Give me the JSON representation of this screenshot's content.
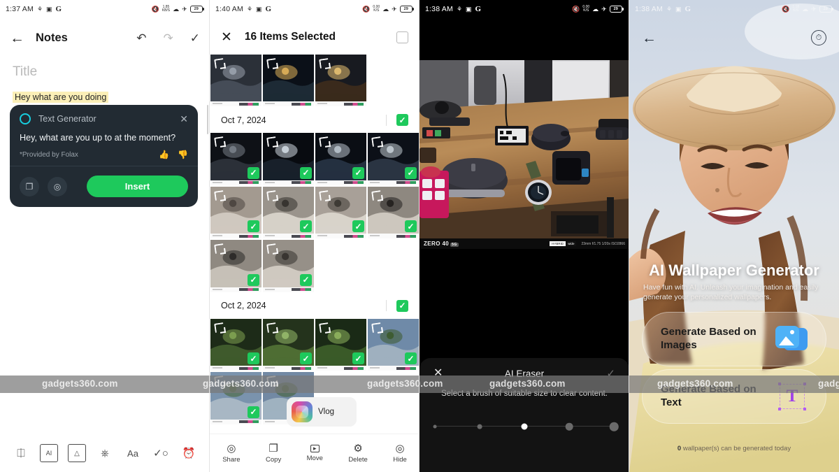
{
  "watermark": {
    "text": "gadgets360.com",
    "positions": [
      60,
      290,
      525,
      700,
      940,
      1170
    ]
  },
  "panel1": {
    "status": {
      "time": "1:37 AM",
      "net_rate": "1.85",
      "net_unit": "KB/S",
      "battery": "29",
      "icons": [
        "bluetooth-icon",
        "sim-icon",
        "google-icon",
        "mute-icon",
        "data-rate-icon",
        "wifi-icon",
        "airplane-icon",
        "battery-icon"
      ]
    },
    "appbar": {
      "back": "←",
      "title": "Notes",
      "undo": "↶",
      "redo": "↷",
      "done": "✓"
    },
    "note": {
      "title_placeholder": "Title",
      "body_text": "Hey what are you doing"
    },
    "text_generator": {
      "name": "Text Generator",
      "close": "✕",
      "result": "Hey, what are you up to at the moment?",
      "provider": "*Provided by Folax",
      "thumbs_up": "👍",
      "thumbs_down": "👎",
      "copy": "❐",
      "share": "☄",
      "insert_label": "Insert",
      "accent_color": "#1ec95c",
      "ring_color": "#17cfe0"
    },
    "toolbar": [
      {
        "icon": "ⓐ",
        "name": "pen-icon"
      },
      {
        "icon": "AI",
        "name": "ai-image-icon"
      },
      {
        "icon": "⛰",
        "name": "image-icon"
      },
      {
        "icon": "♁",
        "name": "mic-icon"
      },
      {
        "icon": "Aa",
        "name": "text-format-icon"
      },
      {
        "icon": "✓",
        "name": "checklist-icon"
      },
      {
        "icon": "⏰",
        "name": "alarm-icon"
      }
    ]
  },
  "panel2": {
    "status": {
      "time": "1:40 AM",
      "net_rate": "0.00",
      "net_unit": "K/S",
      "battery": "29"
    },
    "appbar": {
      "close": "✕",
      "title": "16 Items Selected",
      "select_all": ""
    },
    "sections": [
      {
        "date": "",
        "checked": false,
        "photos": [
          {
            "selected": false,
            "style": "moon-cloud"
          },
          {
            "selected": false,
            "style": "night-street"
          },
          {
            "selected": false,
            "style": "night-town"
          }
        ]
      },
      {
        "date": "Oct 7, 2024",
        "checked": true,
        "photos": [
          {
            "selected": true,
            "style": "tower-a"
          },
          {
            "selected": true,
            "style": "tower-b"
          },
          {
            "selected": true,
            "style": "tower-c"
          },
          {
            "selected": true,
            "style": "tower-d"
          },
          {
            "selected": true,
            "style": "stair-a"
          },
          {
            "selected": true,
            "style": "stair-b"
          },
          {
            "selected": true,
            "style": "stair-c"
          },
          {
            "selected": true,
            "style": "stair-d"
          },
          {
            "selected": true,
            "style": "stair-e"
          },
          {
            "selected": true,
            "style": "stair-f"
          }
        ]
      },
      {
        "date": "Oct 2, 2024",
        "checked": true,
        "photos": [
          {
            "selected": true,
            "style": "forest-a"
          },
          {
            "selected": true,
            "style": "forest-b"
          },
          {
            "selected": true,
            "style": "forest-c"
          },
          {
            "selected": true,
            "style": "road-a"
          },
          {
            "selected": true,
            "style": "road-b"
          },
          {
            "selected": true,
            "style": "road-c"
          }
        ]
      }
    ],
    "vlog_popup": {
      "label": "Vlog"
    },
    "toolbar": [
      {
        "label": "Share",
        "icon": "☄"
      },
      {
        "label": "Copy",
        "icon": "❐"
      },
      {
        "label": "Move",
        "icon": "▸"
      },
      {
        "label": "Delete",
        "icon": "Ὕ1"
      },
      {
        "label": "Hide",
        "icon": "Ⓨ"
      }
    ]
  },
  "panel3": {
    "status": {
      "time": "1:38 AM",
      "net_rate": "0.00",
      "net_unit": "K/S",
      "battery": "29"
    },
    "photo_meta": {
      "brand": "ZERO",
      "model": "40",
      "badge": "5G",
      "exif": "23mm f/1.75 1/20s ISO2866"
    },
    "sheet": {
      "close": "✕",
      "title": "AI Eraser",
      "confirm": "✓",
      "hint": "Select a brush of suitable size to clear content.",
      "brush_sizes": [
        1,
        2,
        3,
        4,
        5
      ],
      "active_brush_index": 2
    }
  },
  "panel4": {
    "status": {
      "time": "1:38 AM",
      "net_rate": "1.18",
      "net_unit": "K/S",
      "battery": "29"
    },
    "appbar": {
      "back": "←",
      "history_icon": "◴"
    },
    "title": "AI Wallpaper Generator",
    "subtitle": "Have fun with AI. Unleash your imagination and easily generate your personalized wallpapers.",
    "buttons": [
      {
        "label": "Generate Based on Images",
        "icon": "image-stack-icon"
      },
      {
        "label": "Generate Based on Text",
        "icon": "text-T-icon"
      }
    ],
    "quota": {
      "count": "0",
      "text": "wallpaper(s) can be generated today"
    }
  }
}
